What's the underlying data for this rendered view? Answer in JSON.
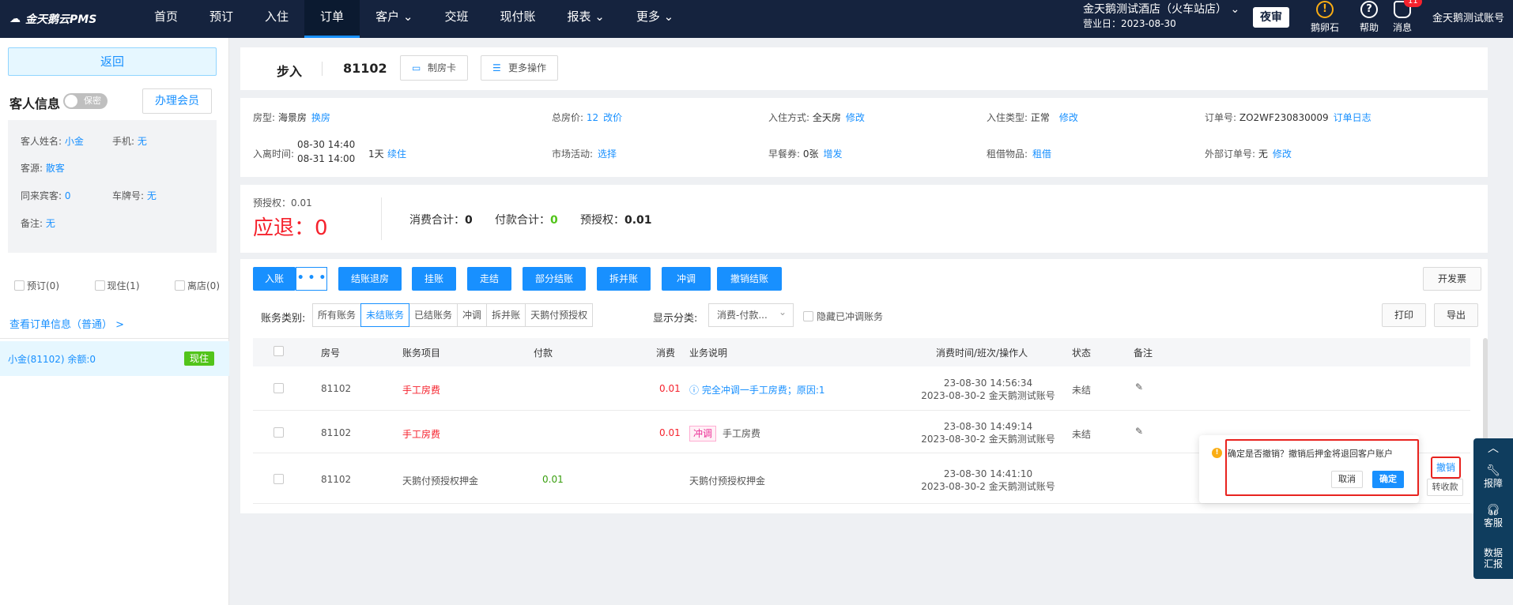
{
  "header": {
    "logo": "金天鹅云PMS",
    "nav": [
      "首页",
      "预订",
      "入住",
      "订单",
      "客户",
      "交班",
      "现付账",
      "报表",
      "更多"
    ],
    "nav_dropdown": [
      "客户",
      "报表",
      "更多"
    ],
    "active_nav": "订单",
    "hotel_name": "金天鹅测试酒店（火车站店）",
    "business_day": "营业日：2023-08-30",
    "night_audit": "夜审",
    "egg_label": "鹅卵石",
    "help_label": "帮助",
    "msg_label": "消息",
    "msg_badge": "11",
    "account": "金天鹅测试账号"
  },
  "sidebar": {
    "back": "返回",
    "guest_info_title": "客人信息",
    "privacy_toggle": "保密",
    "member_btn": "办理会员",
    "name_label": "客人姓名:",
    "name_value": "小金",
    "phone_label": "手机:",
    "phone_value": "无",
    "source_label": "客源:",
    "source_value": "散客",
    "companion_label": "同来宾客:",
    "companion_value": "0",
    "plate_label": "车牌号:",
    "plate_value": "无",
    "remark_label": "备注:",
    "remark_value": "无",
    "filter_reserved": "预订(0)",
    "filter_current": "现住(1)",
    "filter_left": "离店(0)",
    "view_order": "查看订单信息（普通） >",
    "room_item": "小金(81102)  余额:0",
    "room_tag": "现住"
  },
  "order": {
    "status": "步入",
    "room_no": "81102",
    "make_card": "制房卡",
    "more_ops": "更多操作"
  },
  "info": {
    "room_type_label": "房型:",
    "room_type": "海景房",
    "room_type_link": "换房",
    "stay_label": "入离时间:",
    "stay_in": "08-30 14:40",
    "stay_out": "08-31 14:00",
    "stay_nights": "1天",
    "stay_link": "续住",
    "total_label": "总房价:",
    "total_value": "12",
    "total_link": "改价",
    "market_label": "市场活动:",
    "market_link": "选择",
    "checkin_label": "入住方式:",
    "checkin_value": "全天房",
    "checkin_link": "修改",
    "breakfast_label": "早餐券:",
    "breakfast_value": "0张",
    "breakfast_link": "增发",
    "checkin_type_label": "入住类型:",
    "checkin_type_value": "正常",
    "checkin_type_link": "修改",
    "borrow_label": "租借物品:",
    "borrow_link": "租借",
    "order_no_label": "订单号:",
    "order_no": "ZO2WF230830009",
    "order_log": "订单日志",
    "ext_no_label": "外部订单号:",
    "ext_no_value": "无",
    "ext_no_link": "修改"
  },
  "summary": {
    "preauth_small": "预授权：0.01",
    "refund": "应退：",
    "refund_value": "0",
    "consume_label": "消费合计：",
    "consume_value": "0",
    "payment_label": "付款合计：",
    "payment_value": "0",
    "preauth_label": "预授权：",
    "preauth_value": "0.01"
  },
  "actions": {
    "post": "入账",
    "more": "• • •",
    "checkout": "结账退房",
    "hang": "挂账",
    "walk": "走结",
    "partial": "部分结账",
    "split": "拆并账",
    "offset": "冲调",
    "cancel_checkout": "撤销结账",
    "invoice": "开发票",
    "print": "打印",
    "export": "导出"
  },
  "filters": {
    "category_label": "账务类别:",
    "categories": [
      "所有账务",
      "未结账务",
      "已结账务",
      "冲调",
      "拆并账",
      "天鹅付预授权"
    ],
    "active_category": "未结账务",
    "display_label": "显示分类:",
    "display_value": "消费-付款...",
    "hide_offset": "隐藏已冲调账务"
  },
  "table": {
    "headers": [
      "房号",
      "账务项目",
      "付款",
      "消费",
      "业务说明",
      "消费时间/班次/操作人",
      "状态",
      "备注"
    ],
    "rows": [
      {
        "room": "81102",
        "item": "手工房费",
        "payment": "",
        "consume": "0.01",
        "desc": "完全冲调一手工房费；原因:1",
        "tag": "",
        "time": "23-08-30 14:56:34",
        "shift": "2023-08-30-2 金天鹅测试账号",
        "status": "未结"
      },
      {
        "room": "81102",
        "item": "手工房费",
        "payment": "",
        "consume": "0.01",
        "desc": "手工房费",
        "tag": "冲调",
        "time": "23-08-30 14:49:14",
        "shift": "2023-08-30-2 金天鹅测试账号",
        "status": "未结"
      },
      {
        "room": "81102",
        "item": "天鹅付预授权押金",
        "payment": "0.01",
        "consume": "",
        "desc": "天鹅付预授权押金",
        "tag": "",
        "time": "23-08-30 14:41:10",
        "shift": "2023-08-30-2 金天鹅测试账号",
        "status": ""
      }
    ]
  },
  "popconfirm": {
    "message": "确定是否撤销？撤销后押金将退回客户账户",
    "cancel": "取消",
    "confirm": "确定",
    "revoke": "撤销",
    "collect": "转收款"
  },
  "floatbar": {
    "report": "报障",
    "service": "客服",
    "data": "数据",
    "summary": "汇报"
  }
}
